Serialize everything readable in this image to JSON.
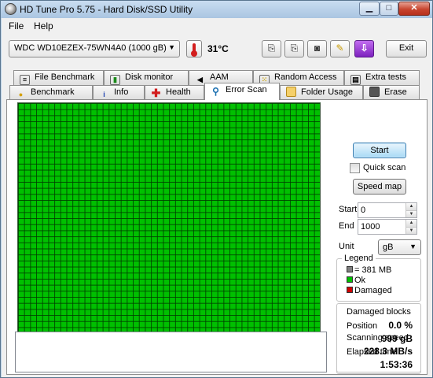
{
  "window": {
    "title": "HD Tune Pro 5.75 - Hard Disk/SSD Utility"
  },
  "menu": [
    "File",
    "Help"
  ],
  "toolbar": {
    "drive": "WDC WD10EZEX-75WN4A0 (1000 gB)",
    "temperature": "31°C",
    "exit_label": "Exit"
  },
  "tabs_top": [
    "File Benchmark",
    "Disk monitor",
    "AAM",
    "Random Access",
    "Extra tests"
  ],
  "tabs_bottom": [
    "Benchmark",
    "Info",
    "Health",
    "Error Scan",
    "Folder Usage",
    "Erase"
  ],
  "active_tab": "Error Scan",
  "controls": {
    "start_label": "Start",
    "quick_scan_label": "Quick scan",
    "quick_scan_checked": false,
    "speed_map_label": "Speed map",
    "start_field_label": "Start",
    "start_value": "0",
    "end_field_label": "End",
    "end_value": "1000",
    "unit_label": "Unit",
    "unit_value": "gB"
  },
  "legend": {
    "title": "Legend",
    "block_size": "= 381 MB",
    "ok": "Ok",
    "damaged": "Damaged"
  },
  "stats": {
    "damaged_blocks_label": "Damaged blocks",
    "damaged_blocks": "0.0 %",
    "scanning_speed_label": "Scanning speed",
    "scanning_speed": "228.3 MB/s",
    "position_label": "Position",
    "position": "999 gB",
    "elapsed_label": "Elapsed time",
    "elapsed": "1:53:36"
  },
  "colors": {
    "ok": "#00c000",
    "damaged": "#d00000",
    "block": "#7f7f7f"
  }
}
